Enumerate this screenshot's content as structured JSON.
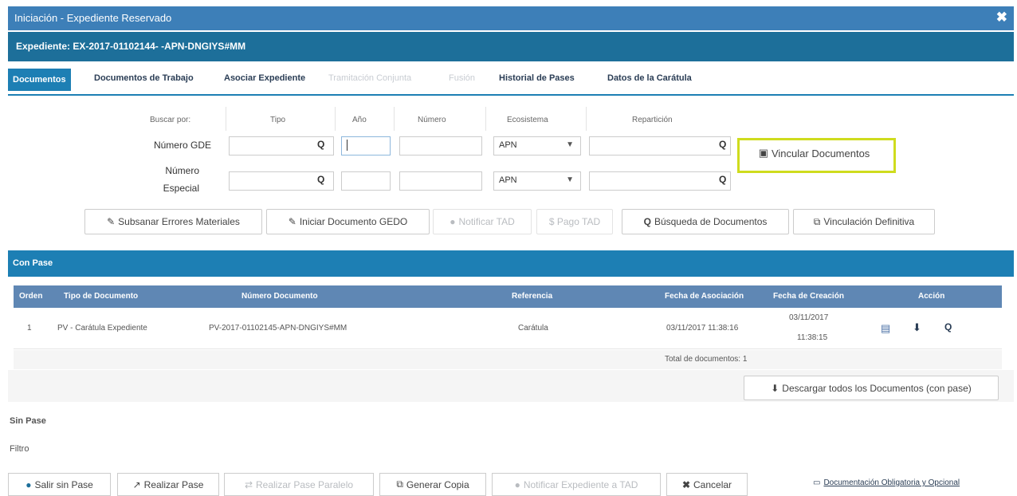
{
  "window": {
    "title": "Iniciación - Expediente Reservado",
    "close": "✖"
  },
  "expediente": {
    "label": "Expediente: EX-2017-01102144- -APN-DNGIYS#MM"
  },
  "tabs": [
    {
      "label": "Documentos",
      "active": true
    },
    {
      "label": "Documentos de Trabajo"
    },
    {
      "label": "Asociar Expediente"
    },
    {
      "label": "Tramitación Conjunta",
      "disabled": true
    },
    {
      "label": "Fusión",
      "disabled": true
    },
    {
      "label": "Historial de Pases"
    },
    {
      "label": "Datos de la Carátula"
    }
  ],
  "search": {
    "headers": {
      "buscar": "Buscar por:",
      "tipo": "Tipo",
      "anio": "Año",
      "numero": "Número",
      "ecosistema": "Ecosistema",
      "reparticion": "Repartición"
    },
    "row1_label": "Número GDE",
    "row2_label_a": "Número",
    "row2_label_b": "Especial",
    "eco1": "APN",
    "eco2": "APN",
    "vincular": "Vincular Documentos"
  },
  "actions": {
    "subsanar": "Subsanar Errores Materiales",
    "iniciar": "Iniciar Documento GEDO",
    "notificar": "Notificar TAD",
    "pago": "$ Pago TAD",
    "busqueda": "Búsqueda de Documentos",
    "vinculacion": "Vinculación Definitiva"
  },
  "con_pase": {
    "title": "Con Pase",
    "columns": {
      "orden": "Orden",
      "tipo": "Tipo de Documento",
      "numero": "Número Documento",
      "referencia": "Referencia",
      "fecha_asoc": "Fecha de Asociación",
      "fecha_crea": "Fecha de Creación",
      "accion": "Acción"
    },
    "row": {
      "orden": "1",
      "tipo": "PV - Carátula Expediente",
      "numero": "PV-2017-01102145-APN-DNGIYS#MM",
      "referencia": "Carátula",
      "fecha_asoc": "03/11/2017 11:38:16",
      "fecha_crea_1": "03/11/2017",
      "fecha_crea_2": "11:38:15"
    },
    "total": "Total de documentos:  1",
    "descargar": "Descargar todos los Documentos (con pase)"
  },
  "sin_pase": "Sin Pase",
  "filtro": "Filtro",
  "bottom": {
    "salir": "Salir sin Pase",
    "realizar": "Realizar Pase",
    "paralelo": "Realizar Pase Paralelo",
    "copia": "Generar Copia",
    "notificar_exp": "Notificar Expediente a TAD",
    "cancelar": "Cancelar",
    "doc_link": "Documentación Obligatoria y Opcional"
  }
}
